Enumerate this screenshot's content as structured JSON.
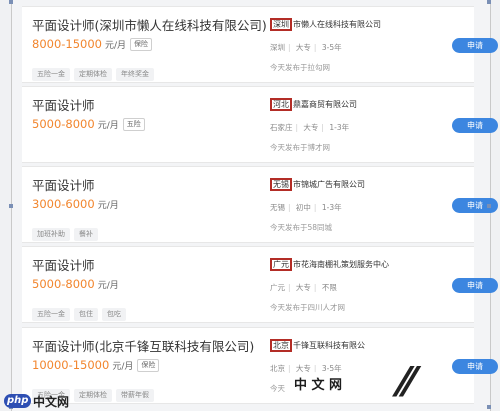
{
  "cards": [
    {
      "title": "平面设计师(深圳市懒人在线科技有限公司)",
      "salary": "8000-15000",
      "unit": "元/月",
      "badge": "保险",
      "tags": [
        "五险一金",
        "定期体检",
        "年终奖金"
      ],
      "company_hl": "深圳",
      "company_rest": "市懒人在线科技有限公司",
      "meta": [
        "深圳",
        "大专",
        "3-5年"
      ],
      "published": "今天发布于拉勾网",
      "apply": "申请"
    },
    {
      "title": "平面设计师",
      "salary": "5000-8000",
      "unit": "元/月",
      "badge": "五险",
      "tags": [],
      "company_hl": "河北",
      "company_rest": "鼎嘉商贸有限公司",
      "meta": [
        "石家庄",
        "大专",
        "1-3年"
      ],
      "published": "今天发布于博才网",
      "apply": "申请"
    },
    {
      "title": "平面设计师",
      "salary": "3000-6000",
      "unit": "元/月",
      "badge": "",
      "tags": [
        "加班补助",
        "餐补"
      ],
      "company_hl": "无锡",
      "company_rest": "市锦城广告有限公司",
      "meta": [
        "无锡",
        "初中",
        "1-3年"
      ],
      "published": "今天发布于58同城",
      "apply": "申请"
    },
    {
      "title": "平面设计师",
      "salary": "5000-8000",
      "unit": "元/月",
      "badge": "",
      "tags": [
        "五险一金",
        "包住",
        "包吃"
      ],
      "company_hl": "广元",
      "company_rest": "市花海南棚礼策划服务中心",
      "meta": [
        "广元",
        "大专",
        "不限"
      ],
      "published": "今天发布于四川人才网",
      "apply": "申请"
    },
    {
      "title": "平面设计师(北京千锋互联科技有限公司)",
      "salary": "10000-15000",
      "unit": "元/月",
      "badge": "保险",
      "tags": [
        "五险一金",
        "定期体检",
        "带薪年假"
      ],
      "company_hl": "北京",
      "company_rest": "千锋互联科技有限公",
      "meta": [
        "北京",
        "大专",
        "3-5年"
      ],
      "published": "今天",
      "apply": "申请"
    }
  ],
  "watermark": {
    "logo": "php",
    "text": "中文网",
    "right": "中 文 网"
  }
}
